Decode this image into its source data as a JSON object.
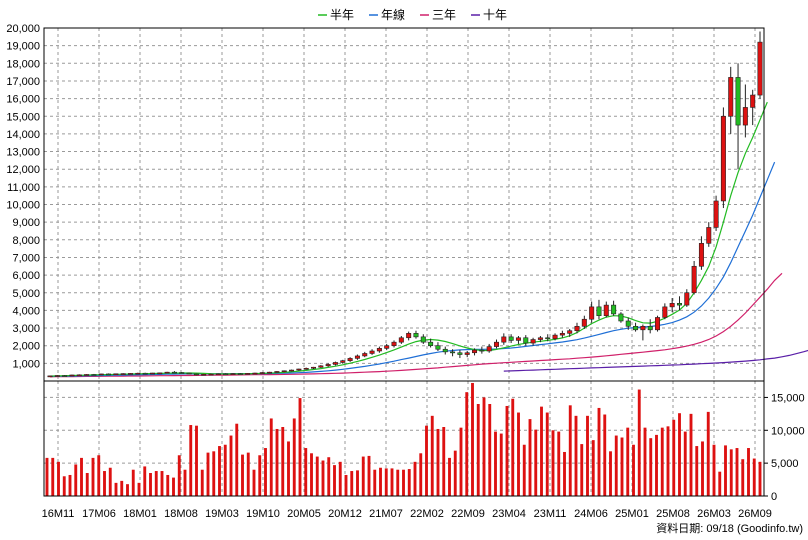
{
  "chart_data": [
    {
      "type": "candlestick-with-moving-averages",
      "legend": [
        {
          "label": "半年",
          "color": "#22bb22"
        },
        {
          "label": "年線",
          "color": "#1f6fd6"
        },
        {
          "label": "三年",
          "color": "#d0206a"
        },
        {
          "label": "十年",
          "color": "#5a1fa8"
        }
      ],
      "legend_position": "top-center",
      "y_ticks": [
        "1,000",
        "2,000",
        "3,000",
        "4,000",
        "5,000",
        "6,000",
        "7,000",
        "8,000",
        "9,000",
        "10,000",
        "11,000",
        "12,000",
        "13,000",
        "14,000",
        "15,000",
        "16,000",
        "17,000",
        "18,000",
        "19,000",
        "20,000"
      ],
      "ylim": [
        0,
        20000
      ],
      "grid": true,
      "candle_colors": {
        "up": "#dd1111",
        "down": "#22bb22"
      },
      "candles": [
        {
          "o": 280,
          "h": 310,
          "l": 250,
          "c": 290
        },
        {
          "o": 290,
          "h": 330,
          "l": 270,
          "c": 310
        },
        {
          "o": 310,
          "h": 340,
          "l": 290,
          "c": 300
        },
        {
          "o": 300,
          "h": 360,
          "l": 290,
          "c": 340
        },
        {
          "o": 340,
          "h": 380,
          "l": 320,
          "c": 350
        },
        {
          "o": 350,
          "h": 390,
          "l": 330,
          "c": 370
        },
        {
          "o": 370,
          "h": 400,
          "l": 340,
          "c": 360
        },
        {
          "o": 360,
          "h": 410,
          "l": 350,
          "c": 400
        },
        {
          "o": 400,
          "h": 430,
          "l": 370,
          "c": 380
        },
        {
          "o": 380,
          "h": 420,
          "l": 360,
          "c": 410
        },
        {
          "o": 410,
          "h": 440,
          "l": 390,
          "c": 420
        },
        {
          "o": 420,
          "h": 450,
          "l": 400,
          "c": 430
        },
        {
          "o": 430,
          "h": 470,
          "l": 410,
          "c": 440
        },
        {
          "o": 440,
          "h": 470,
          "l": 420,
          "c": 430
        },
        {
          "o": 430,
          "h": 460,
          "l": 410,
          "c": 450
        },
        {
          "o": 450,
          "h": 480,
          "l": 430,
          "c": 460
        },
        {
          "o": 460,
          "h": 520,
          "l": 440,
          "c": 500
        },
        {
          "o": 500,
          "h": 560,
          "l": 470,
          "c": 480
        },
        {
          "o": 480,
          "h": 510,
          "l": 430,
          "c": 450
        },
        {
          "o": 450,
          "h": 470,
          "l": 380,
          "c": 400
        },
        {
          "o": 400,
          "h": 420,
          "l": 330,
          "c": 360
        },
        {
          "o": 360,
          "h": 400,
          "l": 330,
          "c": 380
        },
        {
          "o": 380,
          "h": 420,
          "l": 350,
          "c": 390
        },
        {
          "o": 390,
          "h": 430,
          "l": 360,
          "c": 410
        },
        {
          "o": 410,
          "h": 440,
          "l": 380,
          "c": 400
        },
        {
          "o": 400,
          "h": 440,
          "l": 380,
          "c": 420
        },
        {
          "o": 420,
          "h": 450,
          "l": 390,
          "c": 410
        },
        {
          "o": 410,
          "h": 450,
          "l": 390,
          "c": 430
        },
        {
          "o": 430,
          "h": 470,
          "l": 400,
          "c": 450
        },
        {
          "o": 450,
          "h": 500,
          "l": 420,
          "c": 480
        },
        {
          "o": 480,
          "h": 520,
          "l": 450,
          "c": 500
        },
        {
          "o": 500,
          "h": 560,
          "l": 470,
          "c": 540
        },
        {
          "o": 540,
          "h": 600,
          "l": 500,
          "c": 580
        },
        {
          "o": 580,
          "h": 650,
          "l": 540,
          "c": 620
        },
        {
          "o": 620,
          "h": 700,
          "l": 580,
          "c": 680
        },
        {
          "o": 680,
          "h": 760,
          "l": 640,
          "c": 720
        },
        {
          "o": 720,
          "h": 800,
          "l": 680,
          "c": 780
        },
        {
          "o": 780,
          "h": 900,
          "l": 740,
          "c": 860
        },
        {
          "o": 860,
          "h": 1000,
          "l": 800,
          "c": 940
        },
        {
          "o": 940,
          "h": 1100,
          "l": 880,
          "c": 1050
        },
        {
          "o": 1050,
          "h": 1200,
          "l": 980,
          "c": 1150
        },
        {
          "o": 1150,
          "h": 1350,
          "l": 1080,
          "c": 1280
        },
        {
          "o": 1280,
          "h": 1500,
          "l": 1200,
          "c": 1420
        },
        {
          "o": 1420,
          "h": 1650,
          "l": 1350,
          "c": 1560
        },
        {
          "o": 1560,
          "h": 1800,
          "l": 1480,
          "c": 1700
        },
        {
          "o": 1700,
          "h": 1950,
          "l": 1600,
          "c": 1850
        },
        {
          "o": 1850,
          "h": 2100,
          "l": 1750,
          "c": 2000
        },
        {
          "o": 2000,
          "h": 2300,
          "l": 1900,
          "c": 2200
        },
        {
          "o": 2200,
          "h": 2550,
          "l": 2100,
          "c": 2450
        },
        {
          "o": 2450,
          "h": 2800,
          "l": 2300,
          "c": 2700
        },
        {
          "o": 2700,
          "h": 2850,
          "l": 2400,
          "c": 2500
        },
        {
          "o": 2500,
          "h": 2650,
          "l": 2100,
          "c": 2200
        },
        {
          "o": 2200,
          "h": 2400,
          "l": 1900,
          "c": 2000
        },
        {
          "o": 2000,
          "h": 2200,
          "l": 1700,
          "c": 1800
        },
        {
          "o": 1800,
          "h": 1950,
          "l": 1500,
          "c": 1650
        },
        {
          "o": 1650,
          "h": 1800,
          "l": 1400,
          "c": 1600
        },
        {
          "o": 1600,
          "h": 1750,
          "l": 1300,
          "c": 1500
        },
        {
          "o": 1500,
          "h": 1700,
          "l": 1350,
          "c": 1600
        },
        {
          "o": 1600,
          "h": 1850,
          "l": 1450,
          "c": 1750
        },
        {
          "o": 1750,
          "h": 1950,
          "l": 1550,
          "c": 1700
        },
        {
          "o": 1700,
          "h": 2100,
          "l": 1600,
          "c": 1950
        },
        {
          "o": 1950,
          "h": 2350,
          "l": 1850,
          "c": 2200
        },
        {
          "o": 2200,
          "h": 2700,
          "l": 2050,
          "c": 2500
        },
        {
          "o": 2500,
          "h": 2650,
          "l": 2150,
          "c": 2300
        },
        {
          "o": 2300,
          "h": 2550,
          "l": 2100,
          "c": 2450
        },
        {
          "o": 2450,
          "h": 2600,
          "l": 2000,
          "c": 2150
        },
        {
          "o": 2150,
          "h": 2450,
          "l": 2000,
          "c": 2350
        },
        {
          "o": 2350,
          "h": 2550,
          "l": 2200,
          "c": 2450
        },
        {
          "o": 2450,
          "h": 2650,
          "l": 2250,
          "c": 2400
        },
        {
          "o": 2400,
          "h": 2700,
          "l": 2300,
          "c": 2600
        },
        {
          "o": 2600,
          "h": 2850,
          "l": 2450,
          "c": 2700
        },
        {
          "o": 2700,
          "h": 2950,
          "l": 2500,
          "c": 2850
        },
        {
          "o": 2850,
          "h": 3300,
          "l": 2700,
          "c": 3100
        },
        {
          "o": 3100,
          "h": 3700,
          "l": 2950,
          "c": 3500
        },
        {
          "o": 3500,
          "h": 4500,
          "l": 3300,
          "c": 4200
        },
        {
          "o": 4200,
          "h": 4600,
          "l": 3500,
          "c": 3700
        },
        {
          "o": 3700,
          "h": 4500,
          "l": 3600,
          "c": 4300
        },
        {
          "o": 4300,
          "h": 4550,
          "l": 3700,
          "c": 3800
        },
        {
          "o": 3800,
          "h": 3900,
          "l": 3300,
          "c": 3400
        },
        {
          "o": 3400,
          "h": 3600,
          "l": 2900,
          "c": 3100
        },
        {
          "o": 3100,
          "h": 3300,
          "l": 2800,
          "c": 2900
        },
        {
          "o": 2900,
          "h": 3200,
          "l": 2300,
          "c": 3100
        },
        {
          "o": 3100,
          "h": 3500,
          "l": 2700,
          "c": 2900
        },
        {
          "o": 2900,
          "h": 3700,
          "l": 2800,
          "c": 3600
        },
        {
          "o": 3600,
          "h": 4400,
          "l": 3500,
          "c": 4200
        },
        {
          "o": 4200,
          "h": 4700,
          "l": 3900,
          "c": 4400
        },
        {
          "o": 4400,
          "h": 4800,
          "l": 4000,
          "c": 4300
        },
        {
          "o": 4300,
          "h": 5200,
          "l": 4200,
          "c": 5000
        },
        {
          "o": 5000,
          "h": 6800,
          "l": 4900,
          "c": 6500
        },
        {
          "o": 6500,
          "h": 8200,
          "l": 6300,
          "c": 7800
        },
        {
          "o": 7800,
          "h": 9000,
          "l": 7600,
          "c": 8700
        },
        {
          "o": 8700,
          "h": 10500,
          "l": 8500,
          "c": 10200
        },
        {
          "o": 10200,
          "h": 15500,
          "l": 9800,
          "c": 15000
        },
        {
          "o": 15000,
          "h": 17800,
          "l": 14000,
          "c": 17200
        },
        {
          "o": 17200,
          "h": 18000,
          "l": 12000,
          "c": 14500
        },
        {
          "o": 14500,
          "h": 16800,
          "l": 13800,
          "c": 15500
        },
        {
          "o": 15500,
          "h": 16500,
          "l": 14500,
          "c": 16200
        },
        {
          "o": 16200,
          "h": 19800,
          "l": 16000,
          "c": 19200
        }
      ],
      "ma_half_year": [
        280,
        290,
        300,
        310,
        325,
        335,
        345,
        355,
        365,
        375,
        385,
        395,
        405,
        415,
        425,
        432,
        440,
        450,
        455,
        455,
        445,
        430,
        415,
        410,
        405,
        405,
        408,
        412,
        420,
        430,
        445,
        465,
        490,
        520,
        560,
        600,
        650,
        700,
        770,
        840,
        920,
        1010,
        1110,
        1220,
        1340,
        1470,
        1610,
        1760,
        1920,
        2090,
        2230,
        2320,
        2350,
        2320,
        2240,
        2120,
        1990,
        1870,
        1780,
        1730,
        1730,
        1790,
        1880,
        1980,
        2070,
        2140,
        2200,
        2250,
        2300,
        2360,
        2440,
        2560,
        2740,
        3000,
        3250,
        3450,
        3620,
        3700,
        3680,
        3580,
        3420,
        3300,
        3280,
        3380,
        3560,
        3780,
        4020,
        4400,
        5000,
        5700,
        6500,
        7600,
        9000,
        10500,
        11800,
        12900,
        13800,
        14800,
        15800
      ],
      "ma_year": [
        260,
        265,
        272,
        280,
        288,
        296,
        304,
        312,
        320,
        328,
        336,
        344,
        352,
        360,
        368,
        376,
        384,
        392,
        400,
        405,
        408,
        410,
        410,
        410,
        410,
        411,
        412,
        414,
        417,
        420,
        425,
        432,
        442,
        455,
        470,
        490,
        515,
        545,
        580,
        620,
        665,
        715,
        770,
        830,
        895,
        965,
        1040,
        1120,
        1210,
        1300,
        1390,
        1480,
        1560,
        1630,
        1690,
        1730,
        1760,
        1780,
        1790,
        1795,
        1800,
        1815,
        1840,
        1870,
        1910,
        1960,
        2010,
        2060,
        2110,
        2160,
        2210,
        2270,
        2340,
        2430,
        2530,
        2640,
        2750,
        2850,
        2930,
        2990,
        3030,
        3060,
        3090,
        3140,
        3210,
        3310,
        3450,
        3640,
        3900,
        4250,
        4700,
        5250,
        5900,
        6700,
        7600,
        8500,
        9400,
        10400,
        11400,
        12400
      ],
      "ma_three_year": [
        240,
        243,
        246,
        250,
        254,
        258,
        262,
        266,
        270,
        274,
        278,
        282,
        286,
        290,
        294,
        298,
        302,
        306,
        310,
        314,
        318,
        322,
        326,
        330,
        335,
        340,
        345,
        350,
        355,
        360,
        365,
        370,
        375,
        380,
        388,
        396,
        405,
        415,
        425,
        437,
        450,
        465,
        480,
        497,
        515,
        535,
        555,
        578,
        602,
        628,
        655,
        685,
        715,
        745,
        780,
        815,
        850,
        885,
        920,
        955,
        985,
        1010,
        1035,
        1060,
        1085,
        1110,
        1135,
        1160,
        1185,
        1210,
        1235,
        1260,
        1290,
        1320,
        1355,
        1390,
        1430,
        1470,
        1510,
        1550,
        1590,
        1630,
        1675,
        1720,
        1770,
        1830,
        1900,
        1980,
        2080,
        2200,
        2350,
        2550,
        2800,
        3100,
        3450,
        3850,
        4300,
        4750,
        5200,
        5700,
        6100
      ],
      "ma_ten_year_start_index": 62,
      "ma_ten_year": [
        560,
        575,
        590,
        605,
        620,
        635,
        650,
        665,
        680,
        695,
        710,
        725,
        740,
        755,
        770,
        785,
        800,
        815,
        830,
        845,
        860,
        875,
        890,
        905,
        920,
        940,
        960,
        980,
        1000,
        1020,
        1045,
        1070,
        1100,
        1130,
        1160,
        1200,
        1250,
        1300,
        1370,
        1450,
        1550,
        1660,
        1780,
        1920,
        2100,
        2300,
        2500,
        2700
      ],
      "volume_ticks": [
        "0",
        "5,000",
        "10,000",
        "15,000"
      ],
      "volume_ylim": [
        0,
        17500
      ],
      "volume_color": "#dd1111",
      "volumes": [
        5800,
        5800,
        5200,
        3000,
        3200,
        4800,
        5800,
        3500,
        5800,
        6200,
        3800,
        4300,
        2000,
        2300,
        1800,
        4000,
        2000,
        4500,
        3500,
        3800,
        3800,
        3200,
        2800,
        6200,
        4000,
        10800,
        10700,
        4000,
        6600,
        6800,
        7600,
        7800,
        9200,
        11000,
        6300,
        6600,
        4000,
        6200,
        7300,
        11800,
        10200,
        10500,
        8300,
        11800,
        14900,
        7300,
        6500,
        6000,
        5400,
        5900,
        4700,
        5200,
        3200,
        3800,
        3900,
        6000,
        6100,
        4000,
        4300,
        4200,
        4200,
        4000,
        4000,
        4100,
        5200,
        6500,
        10700,
        12200,
        10200,
        10500,
        5800,
        6900,
        10400,
        15800,
        17200,
        14000,
        15000,
        14000,
        9800,
        9500,
        13700,
        14800,
        12700,
        7800,
        11700,
        10100,
        13600,
        12700,
        10000,
        9800,
        6700,
        13800,
        12200,
        7900,
        12200,
        8500,
        13400,
        12400,
        6800,
        9200,
        8900,
        10400,
        7800,
        16200,
        10400,
        8800,
        9300,
        10400,
        10600,
        11600,
        12600,
        9800,
        12500,
        7600,
        8300,
        12800,
        7800,
        3700,
        7700,
        7100,
        7300,
        5600,
        7300,
        5700,
        5200
      ],
      "x_ticks": [
        "16M11",
        "17M06",
        "18M01",
        "18M08",
        "19M03",
        "19M10",
        "20M05",
        "20M12",
        "21M07",
        "22M02",
        "22M09",
        "23M04",
        "23M11",
        "24M06",
        "25M01",
        "25M08",
        "26M03",
        "26M09"
      ],
      "footer": "資料日期: 09/18 (Goodinfo.tw)"
    }
  ]
}
